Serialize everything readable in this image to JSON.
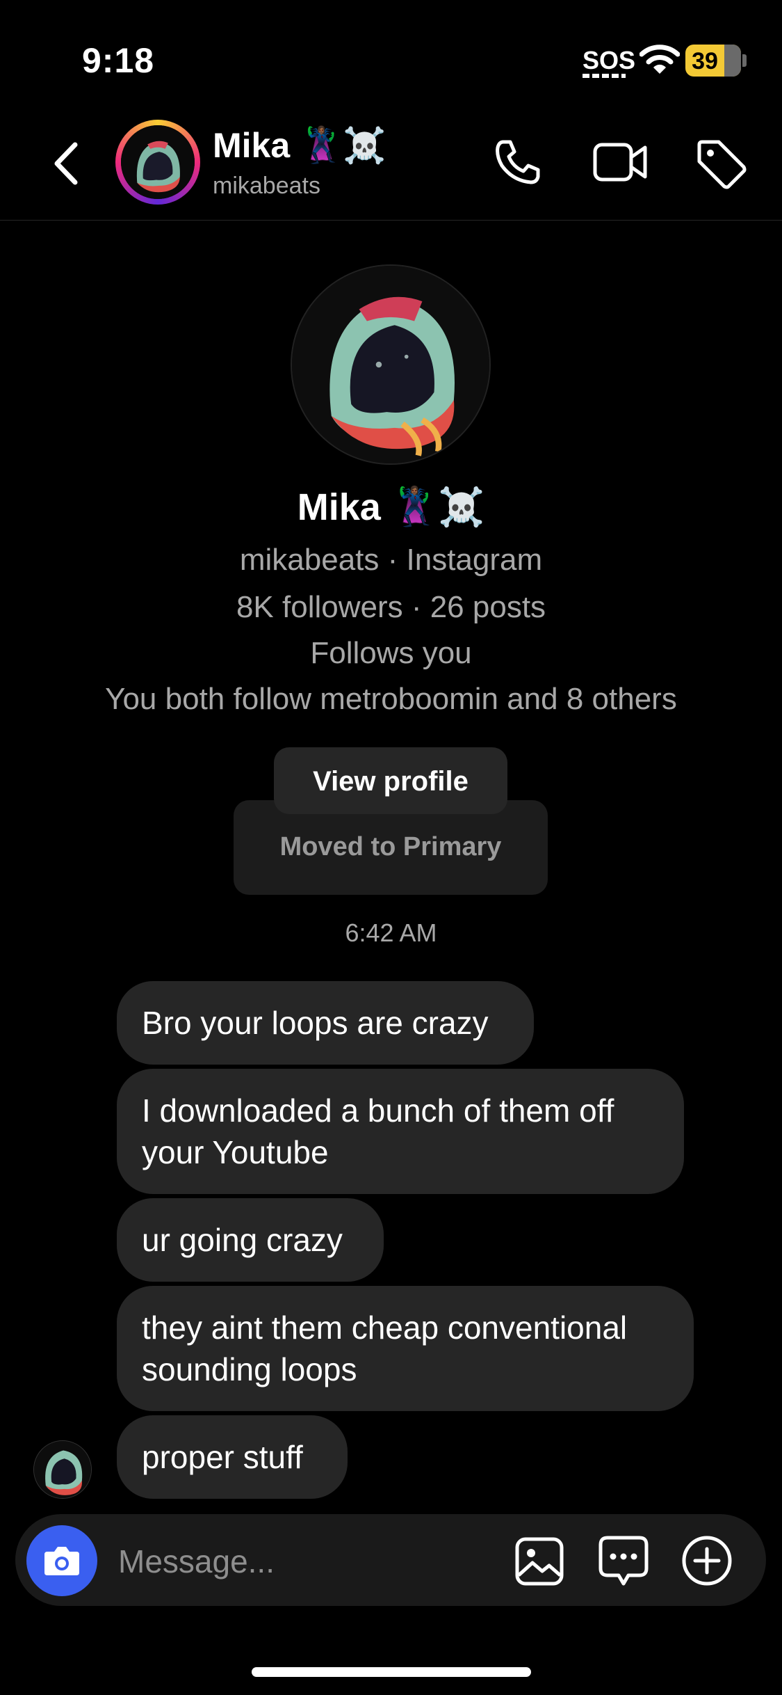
{
  "status": {
    "time": "9:18",
    "carrier_label": "SOS",
    "battery": "39"
  },
  "header": {
    "name": "Mika 🦹🏾‍♀️☠️",
    "username": "mikabeats"
  },
  "profile": {
    "name": "Mika 🦹🏾‍♀️☠️",
    "subtitle": "mikabeats · Instagram",
    "stats": "8K followers · 26 posts",
    "follows": "Follows you",
    "mutuals": "You both follow metroboomin and 8 others",
    "view_profile_label": "View profile",
    "moved_label": "Moved to Primary"
  },
  "thread": {
    "timestamp": "6:42 AM",
    "messages": [
      "Bro your loops are crazy",
      "I downloaded a bunch of them off your Youtube",
      "ur going crazy",
      "they aint them cheap conventional sounding loops",
      "proper stuff"
    ]
  },
  "composer": {
    "placeholder": "Message..."
  },
  "icons": [
    "back-icon",
    "phone-icon",
    "video-icon",
    "tag-icon",
    "camera-icon",
    "gallery-icon",
    "sticker-icon",
    "plus-icon",
    "wifi-icon",
    "battery-icon"
  ],
  "colors": {
    "background": "#000000",
    "bubble": "#262626",
    "camera_button": "#3a5ff0",
    "battery": "#f3c935",
    "secondary_text": "#a8a8a8"
  }
}
